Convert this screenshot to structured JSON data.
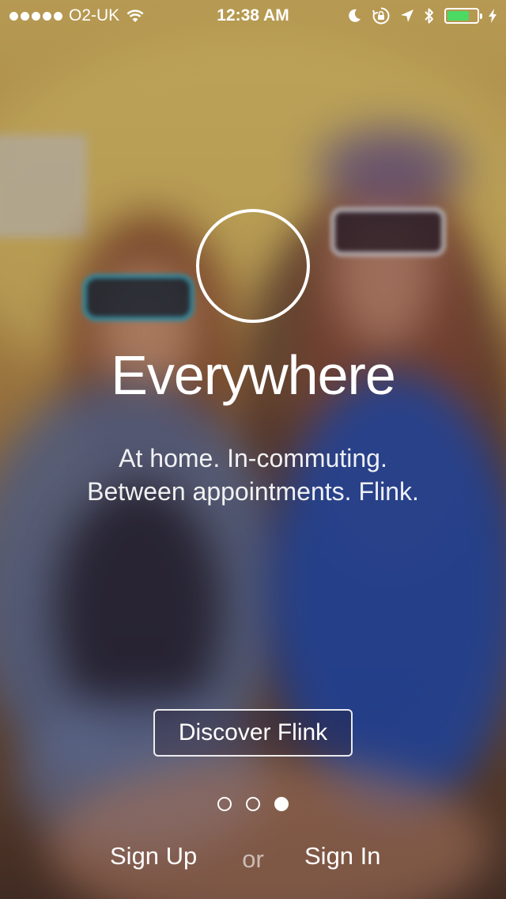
{
  "status_bar": {
    "carrier": "O2-UK",
    "time": "12:38 AM",
    "battery_level": 0.75,
    "battery_color": "#4cd964",
    "icons": [
      "signal-dots-icon",
      "wifi-icon",
      "moon-icon",
      "orientation-lock-icon",
      "location-arrow-icon",
      "bluetooth-icon",
      "battery-icon",
      "charging-bolt-icon"
    ]
  },
  "onboarding": {
    "feature_icon": "circle-outline-icon",
    "title": "Everywhere",
    "subtitle_line1": "At home. In-commuting.",
    "subtitle_line2": "Between appointments. Flink.",
    "discover_label": "Discover Flink",
    "page_count": 3,
    "active_page": 3
  },
  "auth": {
    "sign_up_label": "Sign Up",
    "or_label": "or",
    "sign_in_label": "Sign In"
  }
}
